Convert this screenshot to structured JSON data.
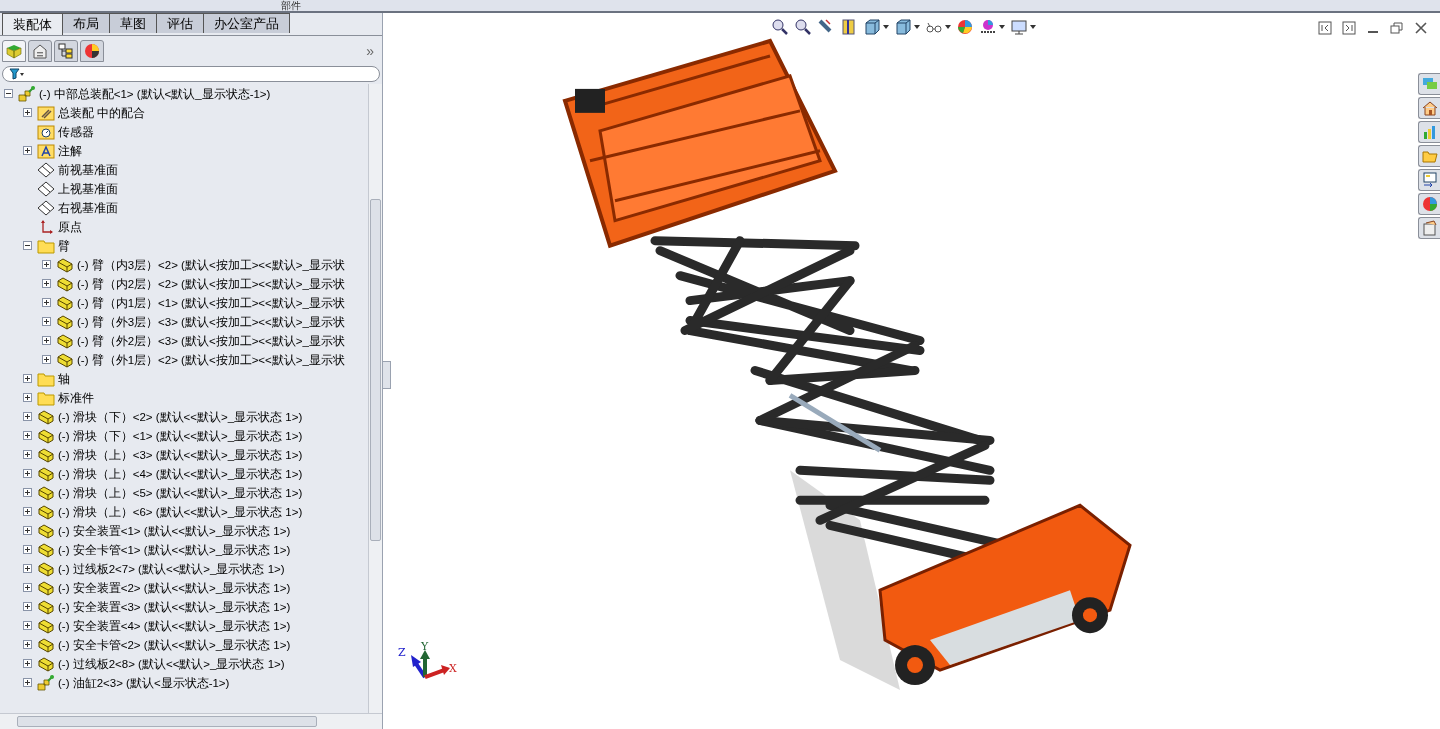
{
  "top_strip": {
    "label": "部件"
  },
  "tabs": [
    {
      "label": "装配体",
      "selected": true
    },
    {
      "label": "布局",
      "selected": false
    },
    {
      "label": "草图",
      "selected": false
    },
    {
      "label": "评估",
      "selected": false
    },
    {
      "label": "办公室产品",
      "selected": false
    }
  ],
  "manager_tabs": [
    {
      "kind": "feature-tree",
      "selected": true
    },
    {
      "kind": "property",
      "selected": false
    },
    {
      "kind": "config",
      "selected": false
    },
    {
      "kind": "display",
      "selected": false
    }
  ],
  "manager_more": "»",
  "tree": [
    {
      "kind": "assembly",
      "label": "(-) 中部总装配<1> (默认<默认_显示状态-1>)",
      "expanded": true,
      "children": [
        {
          "kind": "mates",
          "label": "总装配 中的配合",
          "expanded": false
        },
        {
          "kind": "sensor",
          "label": "传感器"
        },
        {
          "kind": "annotation",
          "label": "注解",
          "expanded": false
        },
        {
          "kind": "plane",
          "label": "前视基准面"
        },
        {
          "kind": "plane",
          "label": "上视基准面"
        },
        {
          "kind": "plane",
          "label": "右视基准面"
        },
        {
          "kind": "origin",
          "label": "原点"
        },
        {
          "kind": "folder",
          "label": "臂",
          "expanded": true,
          "children": [
            {
              "kind": "part",
              "label": "(-) 臂（内3层）<2> (默认<按加工><<默认>_显示状",
              "expanded": false
            },
            {
              "kind": "part",
              "label": "(-) 臂（内2层）<2> (默认<按加工><<默认>_显示状",
              "expanded": false
            },
            {
              "kind": "part",
              "label": "(-) 臂（内1层）<1> (默认<按加工><<默认>_显示状",
              "expanded": false
            },
            {
              "kind": "part",
              "label": "(-) 臂（外3层）<3> (默认<按加工><<默认>_显示状",
              "expanded": false
            },
            {
              "kind": "part",
              "label": "(-) 臂（外2层）<3> (默认<按加工><<默认>_显示状",
              "expanded": false
            },
            {
              "kind": "part",
              "label": "(-) 臂（外1层）<2> (默认<按加工><<默认>_显示状",
              "expanded": false
            }
          ]
        },
        {
          "kind": "folder",
          "label": "轴",
          "expanded": false
        },
        {
          "kind": "folder",
          "label": "标准件",
          "expanded": false
        },
        {
          "kind": "part",
          "label": "(-) 滑块（下）<2> (默认<<默认>_显示状态 1>)",
          "expanded": false
        },
        {
          "kind": "part",
          "label": "(-) 滑块（下）<1> (默认<<默认>_显示状态 1>)",
          "expanded": false
        },
        {
          "kind": "part",
          "label": "(-) 滑块（上）<3> (默认<<默认>_显示状态 1>)",
          "expanded": false
        },
        {
          "kind": "part",
          "label": "(-) 滑块（上）<4> (默认<<默认>_显示状态 1>)",
          "expanded": false
        },
        {
          "kind": "part",
          "label": "(-) 滑块（上）<5> (默认<<默认>_显示状态 1>)",
          "expanded": false
        },
        {
          "kind": "part",
          "label": "(-) 滑块（上）<6> (默认<<默认>_显示状态 1>)",
          "expanded": false
        },
        {
          "kind": "part",
          "label": "(-) 安全装置<1> (默认<<默认>_显示状态 1>)",
          "expanded": false
        },
        {
          "kind": "part",
          "label": "(-) 安全卡管<1> (默认<<默认>_显示状态 1>)",
          "expanded": false
        },
        {
          "kind": "part",
          "label": "(-) 过线板2<7> (默认<<默认>_显示状态 1>)",
          "expanded": false
        },
        {
          "kind": "part",
          "label": "(-) 安全装置<2> (默认<<默认>_显示状态 1>)",
          "expanded": false
        },
        {
          "kind": "part",
          "label": "(-) 安全装置<3> (默认<<默认>_显示状态 1>)",
          "expanded": false
        },
        {
          "kind": "part",
          "label": "(-) 安全装置<4> (默认<<默认>_显示状态 1>)",
          "expanded": false
        },
        {
          "kind": "part",
          "label": "(-) 安全卡管<2> (默认<<默认>_显示状态 1>)",
          "expanded": false
        },
        {
          "kind": "part",
          "label": "(-) 过线板2<8> (默认<<默认>_显示状态 1>)",
          "expanded": false
        },
        {
          "kind": "assembly",
          "label": "(-) 油缸2<3> (默认<显示状态-1>)",
          "expanded": false
        }
      ]
    }
  ],
  "triad": {
    "x": "X",
    "y": "Y",
    "z": "Z"
  }
}
